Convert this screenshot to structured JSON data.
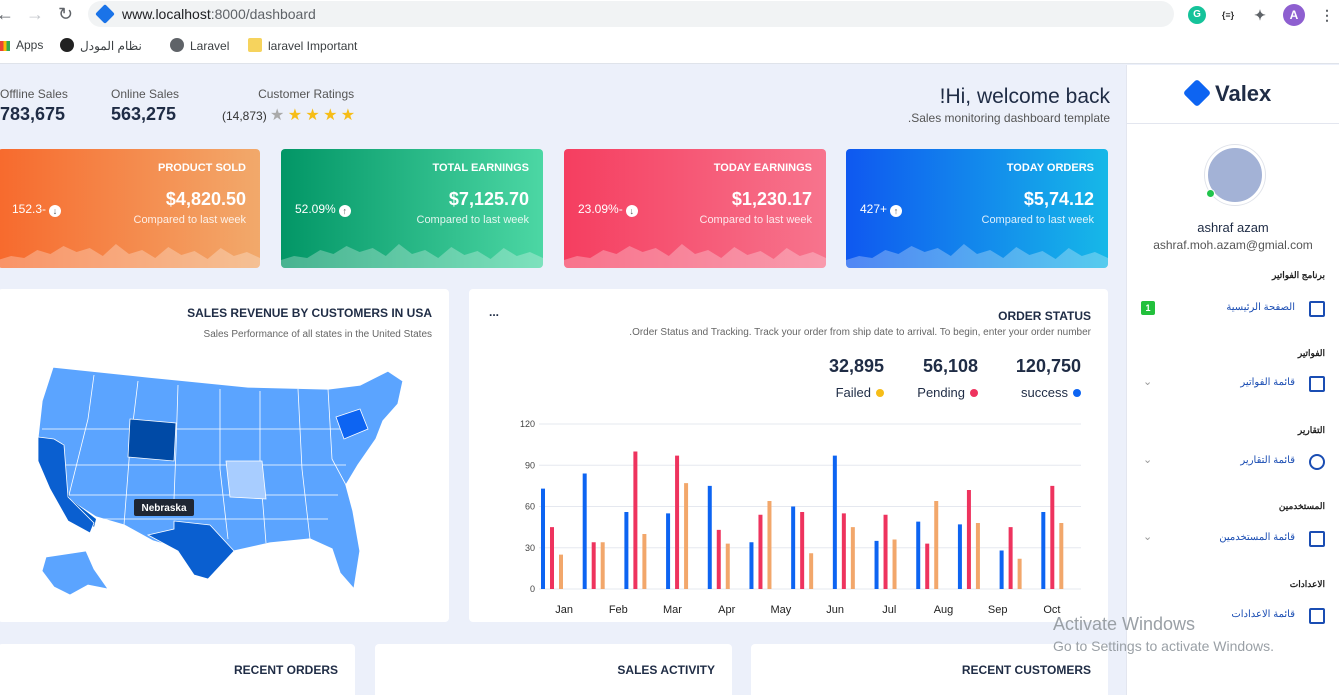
{
  "browser": {
    "url_host": "www.localhost",
    "url_path": ":8000/dashboard",
    "bookmarks": [
      "Apps",
      "نظام المودل",
      "Laravel",
      "laravel Important"
    ],
    "profile_letter": "A"
  },
  "header": {
    "stats": [
      {
        "label": "Offline Sales",
        "value": "783,675"
      },
      {
        "label": "Online Sales",
        "value": "563,275"
      }
    ],
    "ratings": {
      "label": "Customer Ratings",
      "count": "(14,873)",
      "stars": 4.5
    },
    "welcome_title": "!Hi, welcome back",
    "welcome_subtitle": ".Sales monitoring dashboard template"
  },
  "kpis": [
    {
      "title": "PRODUCT SOLD",
      "amount": "$4,820.50",
      "compare": "Compared to last week",
      "pct": "152.3-",
      "dir": "down",
      "colors": [
        "#f76a2d",
        "#f2a96b"
      ]
    },
    {
      "title": "TOTAL EARNINGS",
      "amount": "$7,125.70",
      "compare": "Compared to last week",
      "pct": "52.09%",
      "dir": "up",
      "colors": [
        "#029666",
        "#4cd7a4"
      ]
    },
    {
      "title": "TODAY EARNINGS",
      "amount": "$1,230.17",
      "compare": "Compared to last week",
      "pct": "23.09%-",
      "dir": "down",
      "colors": [
        "#f53e60",
        "#f7748d"
      ]
    },
    {
      "title": "TODAY ORDERS",
      "amount": "$5,74.12",
      "compare": "Compared to last week",
      "pct": "427+",
      "dir": "up",
      "colors": [
        "#0f58f0",
        "#16b8e8"
      ]
    }
  ],
  "map_card": {
    "title": "SALES REVENUE BY CUSTOMERS IN USA",
    "subtitle": "Sales Performance of all states in the United States",
    "tooltip": "Nebraska"
  },
  "order_card": {
    "title": "ORDER STATUS",
    "menu": "...",
    "subtitle": ".Order Status and Tracking. Track your order from ship date to arrival. To begin, enter your order number",
    "legend": [
      {
        "value": "32,895",
        "label": "Failed",
        "color": "#f6bd18"
      },
      {
        "value": "56,108",
        "label": "Pending",
        "color": "#ee335e"
      },
      {
        "value": "120,750",
        "label": "success",
        "color": "#0d64f2"
      }
    ]
  },
  "chart_data": {
    "type": "bar",
    "categories": [
      "Jan",
      "Feb",
      "Mar",
      "Apr",
      "May",
      "Jun",
      "Jul",
      "Aug",
      "Sep",
      "Oct"
    ],
    "ylim": [
      0,
      120
    ],
    "yticks": [
      0,
      30,
      60,
      90,
      120
    ],
    "series": [
      {
        "color": "#0d64f2",
        "values": [
          [
            73,
            45,
            25
          ],
          [
            84,
            34,
            34
          ],
          [
            56,
            100,
            40
          ],
          [
            55,
            97,
            77
          ]
        ]
      },
      {
        "color": "#0d64f2",
        "values": []
      }
    ],
    "groups": [
      [
        [
          73,
          45,
          25
        ],
        [
          84,
          34,
          34
        ]
      ],
      [
        [
          56,
          100,
          40
        ],
        [
          55,
          97,
          77
        ]
      ],
      [
        [
          75,
          43,
          33
        ],
        [
          34,
          54,
          64
        ]
      ],
      [
        [
          60,
          56,
          26
        ],
        [
          97,
          55,
          45
        ]
      ],
      [
        [
          35,
          54,
          36
        ],
        [
          49,
          33,
          64
        ]
      ],
      [
        [
          47,
          72,
          48
        ],
        [
          28,
          45,
          22
        ]
      ],
      [
        [
          56,
          75,
          48
        ]
      ]
    ],
    "bar_colors": [
      "#0d64f2",
      "#ee335e",
      "#f2a76b"
    ],
    "grid": true
  },
  "bottom_cards": [
    {
      "title": "RECENT ORDERS"
    },
    {
      "title": "SALES ACTIVITY"
    },
    {
      "title": "RECENT CUSTOMERS"
    }
  ],
  "watermark": {
    "line1": "Activate Windows",
    "line2": "Go to Settings to activate Windows."
  },
  "sidebar": {
    "brand": "Valex",
    "user_name": "ashraf azam",
    "user_email": "ashraf.moh.azam@gmial.com",
    "sections": [
      {
        "title": "برنامج الفواتير",
        "item": "الصفحة الرئيسية",
        "badge": "1",
        "chev": ""
      },
      {
        "title": "الفواتير",
        "item": "قائمة الفواتير",
        "badge": "",
        "chev": "⌄"
      },
      {
        "title": "التقارير",
        "item": "قائمة التقارير",
        "badge": "",
        "chev": "⌄"
      },
      {
        "title": "المستخدمين",
        "item": "قائمة المستخدمين",
        "badge": "",
        "chev": "⌄"
      },
      {
        "title": "الاعدادات",
        "item": "قائمة الاعدادات",
        "badge": "",
        "chev": ""
      }
    ]
  }
}
